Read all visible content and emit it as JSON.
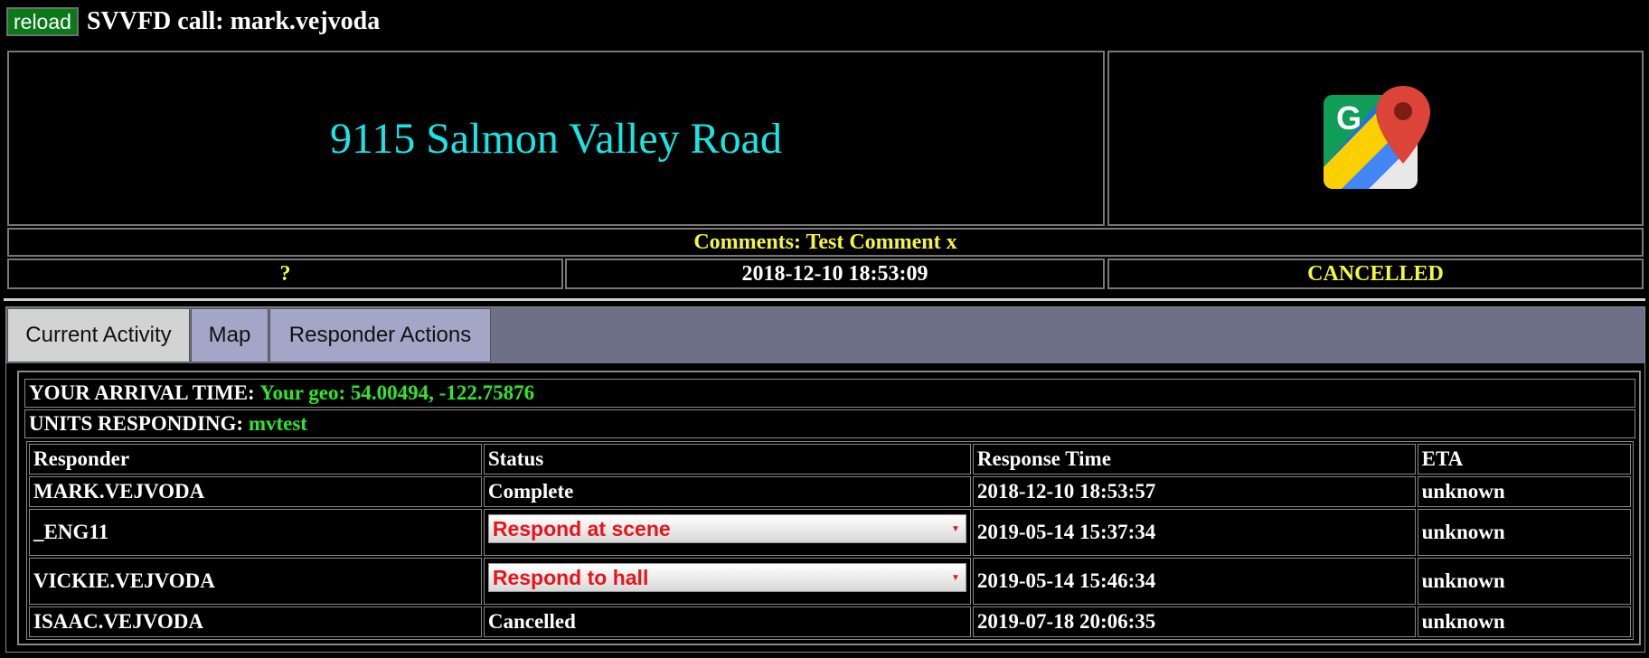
{
  "topbar": {
    "reload_label": "reload",
    "title": "SVVFD call: mark.vejvoda"
  },
  "call": {
    "address": "9115 Salmon Valley Road",
    "map_icon": "google-maps-icon",
    "comments": "Comments: Test Comment x",
    "unknown_marker": "?",
    "datetime": "2018-12-10 18:53:09",
    "status": "CANCELLED"
  },
  "tabs": [
    {
      "label": "Current Activity",
      "active": true
    },
    {
      "label": "Map",
      "active": false
    },
    {
      "label": "Responder Actions",
      "active": false
    }
  ],
  "activity": {
    "arrival_label": "YOUR ARRIVAL TIME:",
    "arrival_value": "Your geo: 54.00494, -122.75876",
    "units_label": "UNITS RESPONDING:",
    "units_value": "mvtest",
    "columns": [
      "Responder",
      "Status",
      "Response Time",
      "ETA"
    ],
    "rows": [
      {
        "responder": "MARK.VEJVODA",
        "status": "Complete",
        "status_is_select": false,
        "response_time": "2018-12-10 18:53:57",
        "eta": "unknown"
      },
      {
        "responder": "_ENG11",
        "status": "Respond at scene",
        "status_is_select": true,
        "response_time": "2019-05-14 15:37:34",
        "eta": "unknown"
      },
      {
        "responder": "VICKIE.VEJVODA",
        "status": "Respond to hall",
        "status_is_select": true,
        "response_time": "2019-05-14 15:46:34",
        "eta": "unknown"
      },
      {
        "responder": "ISAAC.VEJVODA",
        "status": "Cancelled",
        "status_is_select": false,
        "response_time": "2019-07-18 20:06:35",
        "eta": "unknown"
      }
    ]
  },
  "colors": {
    "address": "#18e6e6",
    "highlight": "#f5f542",
    "geo": "#2ee62e",
    "select_text": "#e8141c",
    "reload_bg": "#0a7a19"
  }
}
